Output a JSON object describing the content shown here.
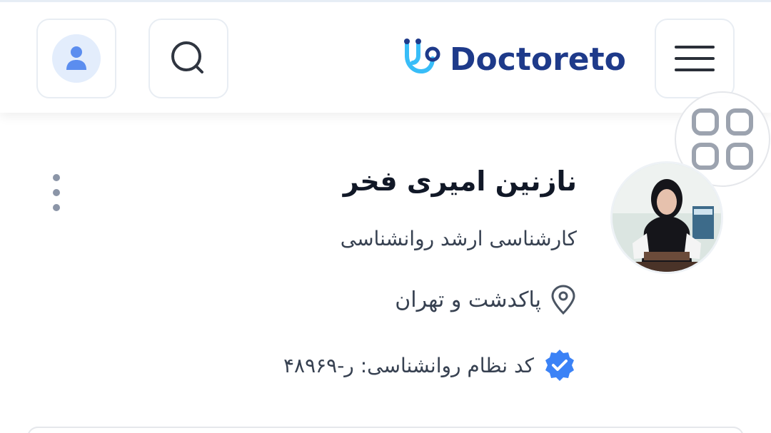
{
  "header": {
    "logo_text": "Doctoreto",
    "icons": {
      "profile": "user-icon",
      "search": "search-icon",
      "menu": "hamburger-menu-icon",
      "logo_mark": "stethoscope-icon",
      "grid": "grid-icon"
    }
  },
  "doctor": {
    "name": "نازنین امیری فخر",
    "title": "کارشناسی ارشد روانشناسی",
    "location": "پاکدشت و تهران",
    "license": "کد نظام روانشناسی: ر-۴۸۹۶۹",
    "icons": {
      "location": "map-pin-icon",
      "verified": "verified-badge-icon",
      "more": "more-vertical-icon"
    }
  },
  "colors": {
    "brand_dark": "#1e3a8a",
    "brand_light": "#38bdf8",
    "verified": "#3b82f6",
    "avatar_bg": "#e3edfc"
  }
}
